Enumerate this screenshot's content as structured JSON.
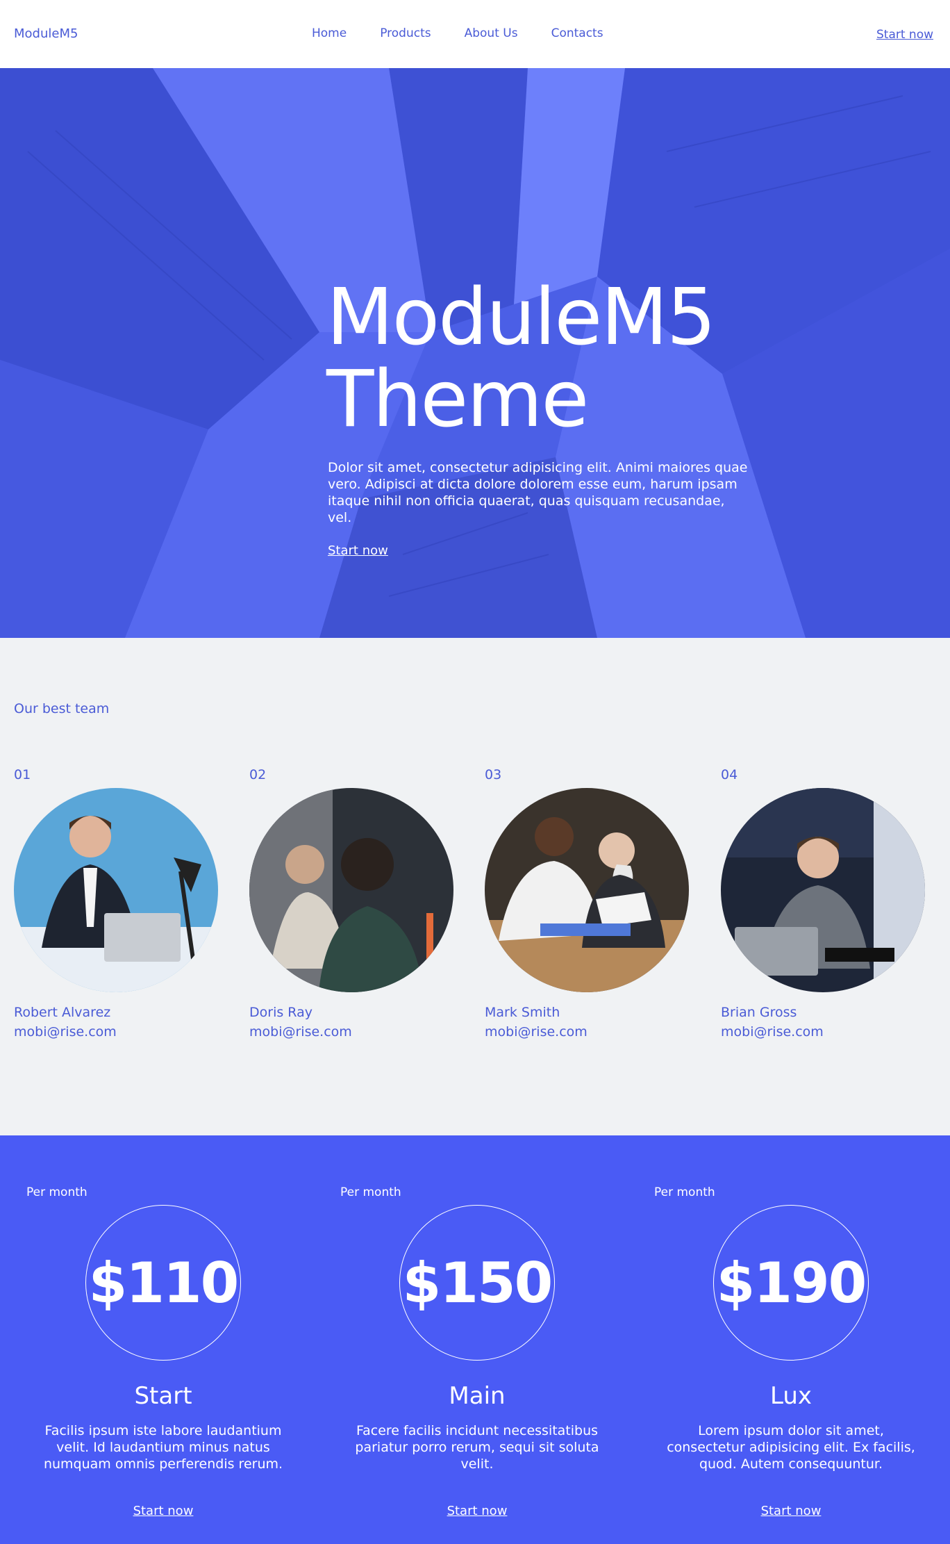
{
  "header": {
    "logo": "ModuleM5",
    "nav": [
      "Home",
      "Products",
      "About Us",
      "Contacts"
    ],
    "cta": "Start now"
  },
  "hero": {
    "title_line1": "ModuleM5",
    "title_line2": "Theme",
    "text": "Dolor sit amet, consectetur adipisicing elit. Animi maiores quae vero. Adipisci at dicta dolore dolorem esse eum, harum ipsam itaque nihil non officia quaerat, quas quisquam recusandae, vel.",
    "cta": "Start now"
  },
  "team": {
    "heading": "Our best team",
    "members": [
      {
        "num": "01",
        "name": "Robert Alvarez",
        "email": "mobi@rise.com"
      },
      {
        "num": "02",
        "name": "Doris Ray",
        "email": "mobi@rise.com"
      },
      {
        "num": "03",
        "name": "Mark Smith",
        "email": "mobi@rise.com"
      },
      {
        "num": "04",
        "name": "Brian Gross",
        "email": "mobi@rise.com"
      }
    ]
  },
  "pricing": {
    "plans": [
      {
        "per": "Per month",
        "price": "$110",
        "name": "Start",
        "desc": "Facilis ipsum iste labore laudantium velit. Id laudantium minus natus numquam omnis perferendis rerum.",
        "cta": "Start now"
      },
      {
        "per": "Per month",
        "price": "$150",
        "name": "Main",
        "desc": "Facere facilis incidunt necessitatibus pariatur porro rerum, sequi sit soluta velit.",
        "cta": "Start now"
      },
      {
        "per": "Per month",
        "price": "$190",
        "name": "Lux",
        "desc": "Lorem ipsum dolor sit amet, consectetur adipisicing elit. Ex facilis, quod. Autem consequuntur.",
        "cta": "Start now"
      }
    ]
  },
  "colors": {
    "accent": "#4a5bd6",
    "hero_bg": "#4b5fe6",
    "pricing_bg": "#4a5bf5",
    "team_bg": "#f0f2f4"
  }
}
